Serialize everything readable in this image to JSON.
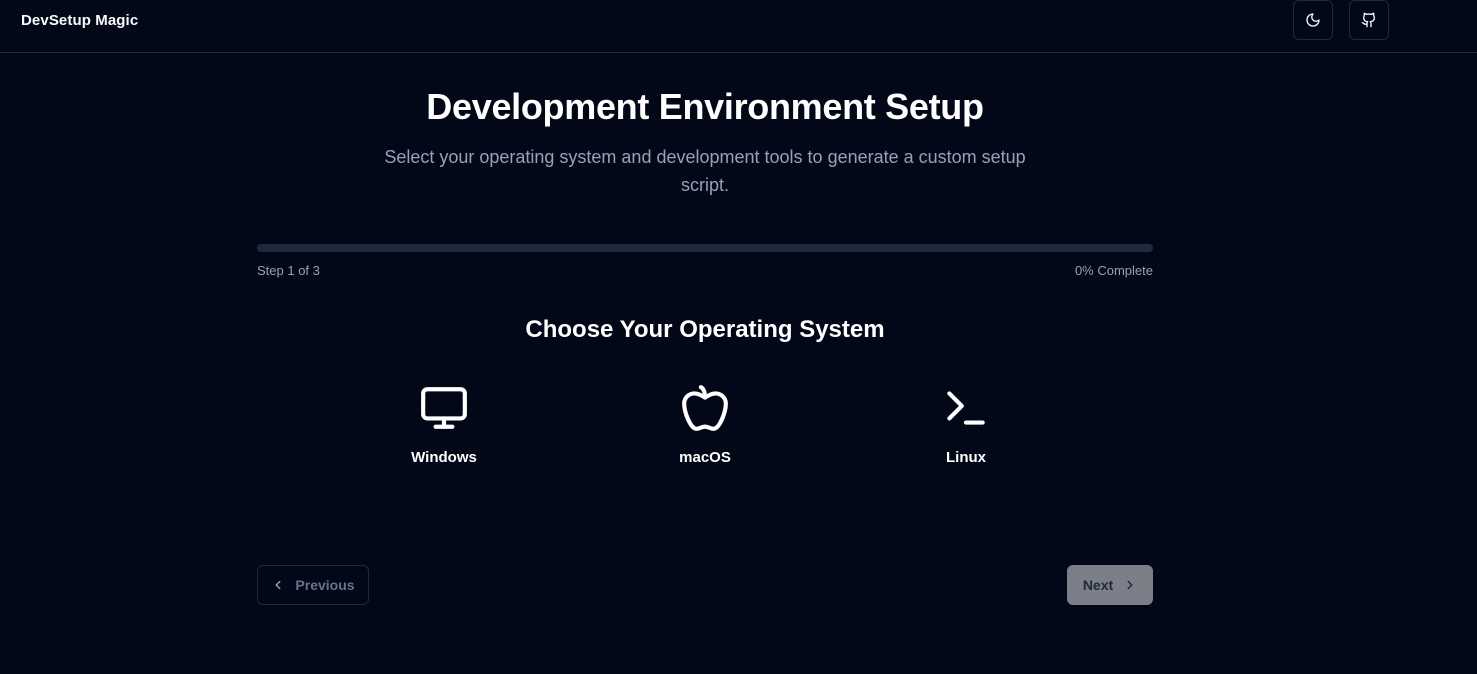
{
  "header": {
    "brand": "DevSetup Magic",
    "theme_toggle_icon": "moon-icon",
    "github_icon": "github-icon"
  },
  "hero": {
    "title": "Development Environment Setup",
    "subtitle": "Select your operating system and development tools to generate a custom setup script."
  },
  "progress": {
    "step_text": "Step 1 of 3",
    "percent_text": "0% Complete",
    "value": 0
  },
  "os_section": {
    "title": "Choose Your Operating System",
    "options": [
      {
        "label": "Windows",
        "icon": "monitor-icon"
      },
      {
        "label": "macOS",
        "icon": "apple-icon"
      },
      {
        "label": "Linux",
        "icon": "terminal-icon"
      }
    ]
  },
  "nav": {
    "previous_label": "Previous",
    "next_label": "Next"
  },
  "colors": {
    "background": "#020817",
    "border": "#1e293b",
    "muted_text": "#94a3b8",
    "next_button_bg": "#7c7f87"
  }
}
